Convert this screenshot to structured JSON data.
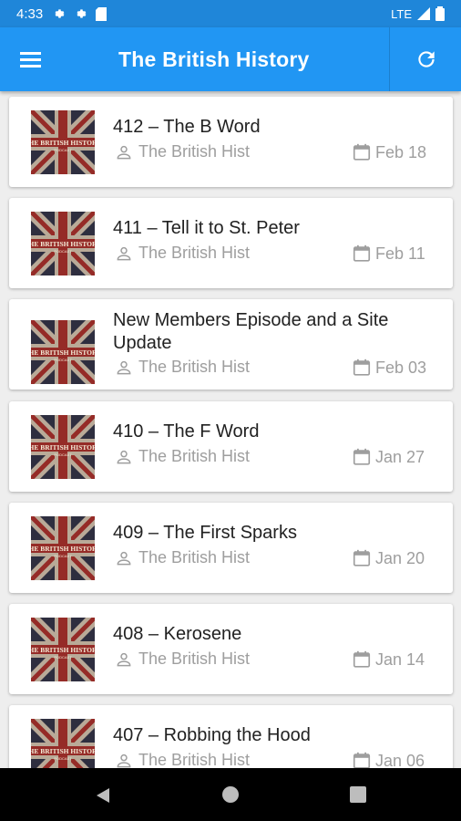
{
  "status_bar": {
    "time": "4:33",
    "network": "LTE"
  },
  "app_bar": {
    "title": "The British History"
  },
  "episodes": [
    {
      "title": "412 – The B Word",
      "author": "The British Hist",
      "date": "Feb 18"
    },
    {
      "title": "411 – Tell it to St. Peter",
      "author": "The British Hist",
      "date": "Feb 11"
    },
    {
      "title": "New Members Episode and a Site Update",
      "author": "The British Hist",
      "date": "Feb 03"
    },
    {
      "title": "410 – The F Word",
      "author": "The British Hist",
      "date": "Jan 27"
    },
    {
      "title": "409 – The First Sparks",
      "author": "The British Hist",
      "date": "Jan 20"
    },
    {
      "title": "408 – Kerosene",
      "author": "The British Hist",
      "date": "Jan 14"
    },
    {
      "title": "407 – Robbing the Hood",
      "author": "The British Hist",
      "date": "Jan 06"
    }
  ],
  "thumbnail_text": {
    "line1": "THE BRITISH HISTORY",
    "line2": "PODCAST"
  },
  "colors": {
    "primary": "#2196f3",
    "status_bar": "#1f86d9",
    "text_primary": "#212121",
    "text_secondary": "#9e9e9e"
  },
  "icons": {
    "menu": "hamburger-menu-icon",
    "refresh": "refresh-icon",
    "author": "person-icon",
    "date": "calendar-icon"
  }
}
